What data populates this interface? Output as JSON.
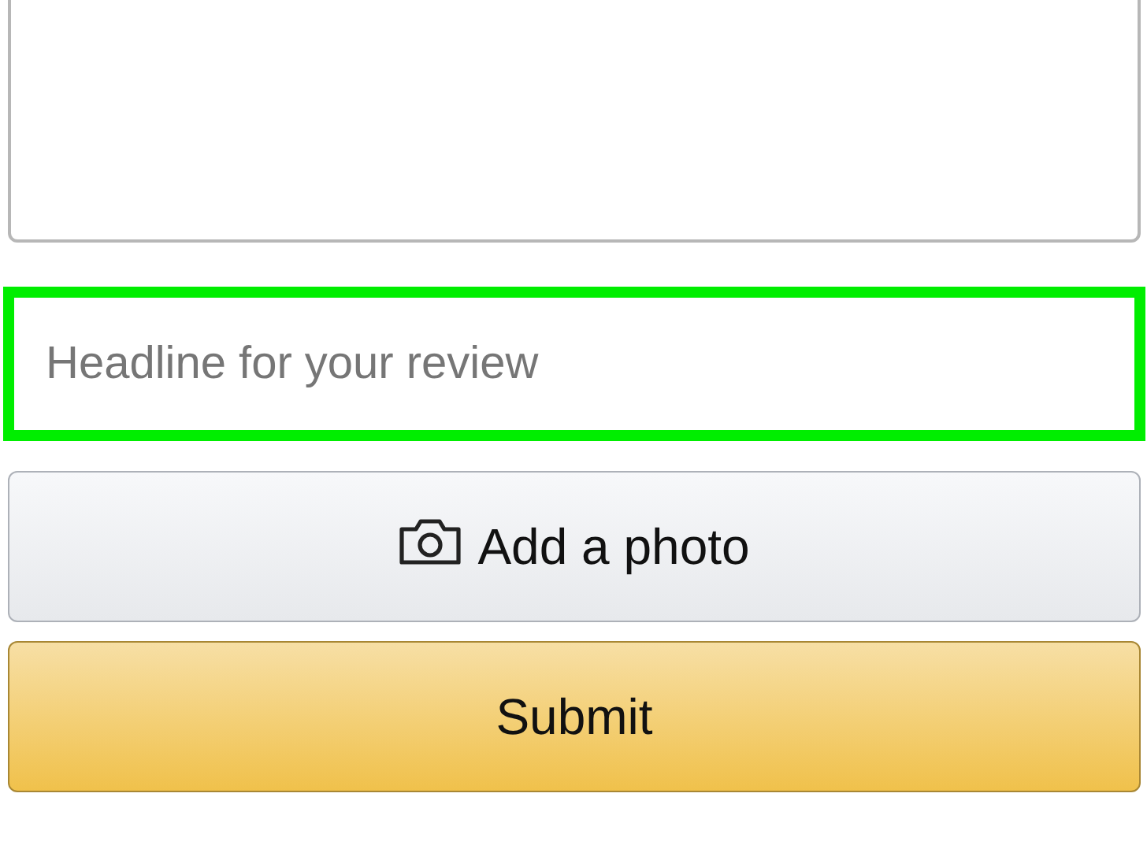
{
  "headline_field": {
    "placeholder": "Headline for your review",
    "highlighted": true
  },
  "buttons": [
    {
      "kind": "secondary",
      "label": "Add a photo"
    },
    {
      "kind": "primary",
      "label": "Submit"
    }
  ]
}
